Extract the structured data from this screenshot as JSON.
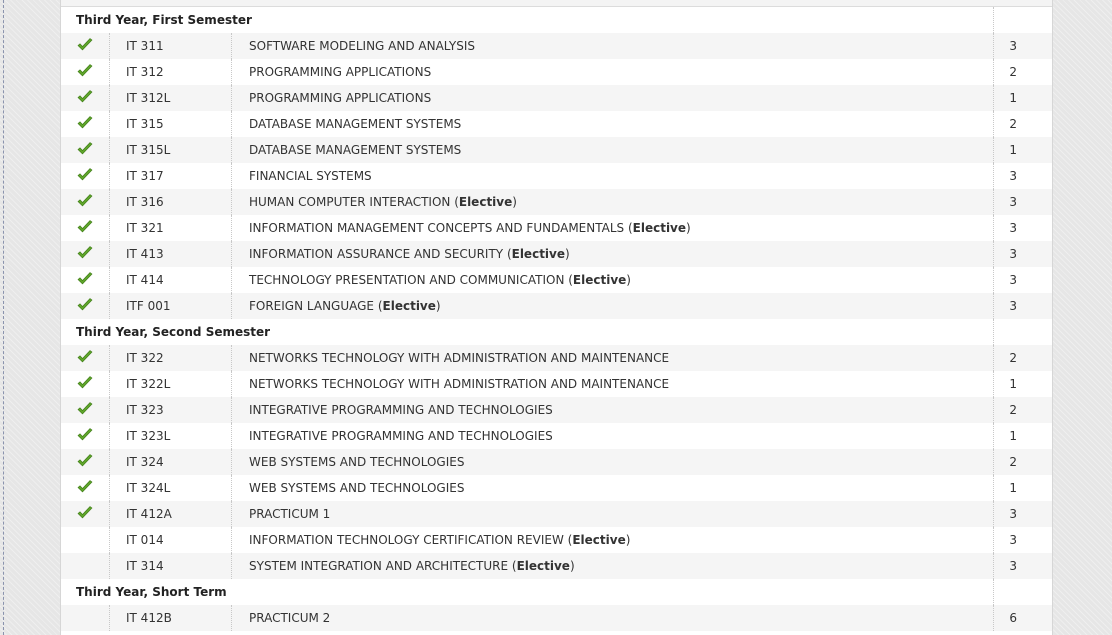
{
  "icons": {
    "passed": "check-mark-icon"
  },
  "colors": {
    "check": "#5fa52a",
    "row_alt": "#f5f5f5"
  },
  "elective_label": "Elective",
  "semesters": [
    {
      "title": "Third Year, First Semester",
      "courses": [
        {
          "code": "IT 311",
          "title": "SOFTWARE MODELING AND ANALYSIS",
          "units": "3",
          "passed": true,
          "elective": false
        },
        {
          "code": "IT 312",
          "title": "PROGRAMMING APPLICATIONS",
          "units": "2",
          "passed": true,
          "elective": false
        },
        {
          "code": "IT 312L",
          "title": "PROGRAMMING APPLICATIONS",
          "units": "1",
          "passed": true,
          "elective": false
        },
        {
          "code": "IT 315",
          "title": "DATABASE MANAGEMENT SYSTEMS",
          "units": "2",
          "passed": true,
          "elective": false
        },
        {
          "code": "IT 315L",
          "title": "DATABASE MANAGEMENT SYSTEMS",
          "units": "1",
          "passed": true,
          "elective": false
        },
        {
          "code": "IT 317",
          "title": "FINANCIAL SYSTEMS",
          "units": "3",
          "passed": true,
          "elective": false
        },
        {
          "code": "IT 316",
          "title": "HUMAN COMPUTER INTERACTION",
          "units": "3",
          "passed": true,
          "elective": true
        },
        {
          "code": "IT 321",
          "title": "INFORMATION MANAGEMENT CONCEPTS AND FUNDAMENTALS",
          "units": "3",
          "passed": true,
          "elective": true
        },
        {
          "code": "IT 413",
          "title": "INFORMATION ASSURANCE AND SECURITY",
          "units": "3",
          "passed": true,
          "elective": true
        },
        {
          "code": "IT 414",
          "title": "TECHNOLOGY PRESENTATION AND COMMUNICATION",
          "units": "3",
          "passed": true,
          "elective": true
        },
        {
          "code": "ITF 001",
          "title": "FOREIGN LANGUAGE",
          "units": "3",
          "passed": true,
          "elective": true
        }
      ]
    },
    {
      "title": "Third Year, Second Semester",
      "courses": [
        {
          "code": "IT 322",
          "title": "NETWORKS TECHNOLOGY WITH ADMINISTRATION AND MAINTENANCE",
          "units": "2",
          "passed": true,
          "elective": false
        },
        {
          "code": "IT 322L",
          "title": "NETWORKS TECHNOLOGY WITH ADMINISTRATION AND MAINTENANCE",
          "units": "1",
          "passed": true,
          "elective": false
        },
        {
          "code": "IT 323",
          "title": "INTEGRATIVE PROGRAMMING AND TECHNOLOGIES",
          "units": "2",
          "passed": true,
          "elective": false
        },
        {
          "code": "IT 323L",
          "title": "INTEGRATIVE PROGRAMMING AND TECHNOLOGIES",
          "units": "1",
          "passed": true,
          "elective": false
        },
        {
          "code": "IT 324",
          "title": "WEB SYSTEMS AND TECHNOLOGIES",
          "units": "2",
          "passed": true,
          "elective": false
        },
        {
          "code": "IT 324L",
          "title": "WEB SYSTEMS AND TECHNOLOGIES",
          "units": "1",
          "passed": true,
          "elective": false
        },
        {
          "code": "IT 412A",
          "title": "PRACTICUM 1",
          "units": "3",
          "passed": true,
          "elective": false
        },
        {
          "code": "IT 014",
          "title": "INFORMATION TECHNOLOGY CERTIFICATION REVIEW",
          "units": "3",
          "passed": false,
          "elective": true
        },
        {
          "code": "IT 314",
          "title": "SYSTEM INTEGRATION AND ARCHITECTURE",
          "units": "3",
          "passed": false,
          "elective": true
        }
      ]
    },
    {
      "title": "Third Year, Short Term",
      "courses": [
        {
          "code": "IT 412B",
          "title": "PRACTICUM 2",
          "units": "6",
          "passed": false,
          "elective": false
        }
      ]
    }
  ]
}
